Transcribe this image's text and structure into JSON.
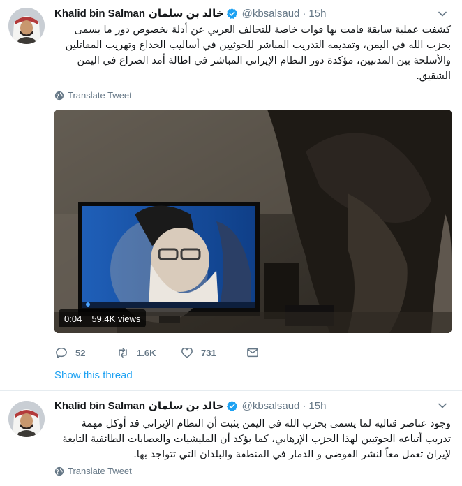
{
  "tweets": [
    {
      "author_name": "Khalid bin Salman",
      "author_name_ar": "خالد بن سلمان",
      "handle": "@kbsalsaud",
      "separator": "·",
      "time": "15h",
      "text": "كشفت عملية سابقة قامت بها قوات خاصة للتحالف العربي عن أدلة بخصوص دور ما يسمى بحزب الله في اليمن، وتقديمه التدريب المباشر للحوثيين في أساليب الخداع وتهريب المقاتلين والأسلحة بين المدنيين، مؤكدة دور النظام الإيراني المباشر في اطالة أمد الصراع في اليمن الشقيق.",
      "translate_label": "Translate Tweet",
      "video": {
        "elapsed": "0:04",
        "views": "59.4K views"
      },
      "actions": {
        "replies": "52",
        "retweets": "1.6K",
        "likes": "731"
      },
      "show_thread_label": "Show this thread"
    },
    {
      "author_name": "Khalid bin Salman",
      "author_name_ar": "خالد بن سلمان",
      "handle": "@kbsalsaud",
      "separator": "·",
      "time": "15h",
      "text": "وجود عناصر قتاليه لما يسمى بحزب الله  في اليمن يثبت أن النظام الإيراني قد أوكل مهمة تدريب أتباعه الحوثيين لهذا الحزب الإرهابي، كما يؤكد أن المليشيات والعصابات الطائفية التابعة لإيران تعمل معاً لنشر الفوضى و الدمار في المنطقة والبلدان التي تتواجد بها.",
      "translate_label": "Translate Tweet"
    }
  ],
  "colors": {
    "accent": "#1da1f2",
    "secondary_text": "#657786",
    "divider": "#e6ecf0"
  },
  "icons": {
    "verified": "verified-badge-icon",
    "caret": "chevron-down-icon",
    "translate": "globe-icon",
    "reply": "reply-icon",
    "retweet": "retweet-icon",
    "like": "heart-icon",
    "dm": "direct-message-icon"
  }
}
